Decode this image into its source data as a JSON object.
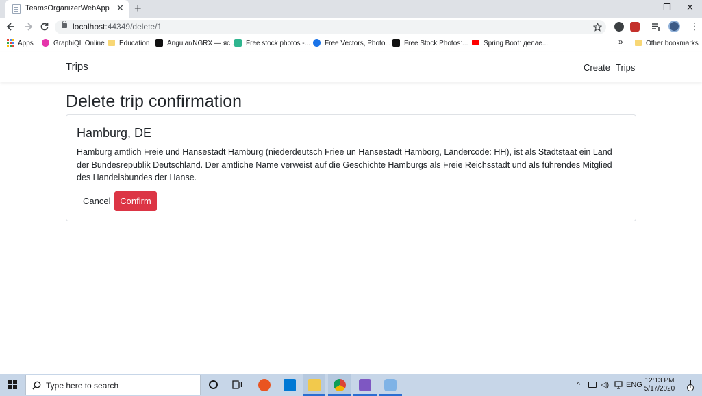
{
  "browser": {
    "tab_title": "TeamsOrganizerWebApp",
    "close_glyph": "✕",
    "new_tab_glyph": "+",
    "url_host": "localhost",
    "url_rest": ":44349/delete/1",
    "window_controls": [
      "—",
      "❐",
      "✕"
    ],
    "icons": {
      "back": "back-arrow-icon",
      "forward": "forward-arrow-icon",
      "reload": "reload-icon",
      "star": "star-icon",
      "menu": "more-vert-icon"
    }
  },
  "bookmarks": {
    "apps": "Apps",
    "items": [
      {
        "label": "GraphiQL Online",
        "color": "#e535ab"
      },
      {
        "label": "Education",
        "color": "#f8d775"
      },
      {
        "label": "Angular/NGRX — яс...",
        "color": "#111111"
      },
      {
        "label": "Free stock photos -...",
        "color": "#2fb58f"
      },
      {
        "label": "Free Vectors, Photo...",
        "color": "#1a73e8"
      },
      {
        "label": "Free Stock Photos:...",
        "color": "#111111"
      },
      {
        "label": "Spring Boot: делае...",
        "color": "#ff0000"
      }
    ],
    "overflow": "»",
    "other": "Other bookmarks"
  },
  "navbar": {
    "brand": "Trips",
    "links": [
      "Create",
      "Trips"
    ]
  },
  "page": {
    "heading": "Delete trip confirmation",
    "card": {
      "title": "Hamburg, DE",
      "text": "Hamburg amtlich Freie und Hansestadt Hamburg (niederdeutsch Friee un Hansestadt Hamborg, Ländercode: HH), ist als Stadtstaat ein Land der Bundesrepublik Deutschland. Der amtliche Name verweist auf die Geschichte Hamburgs als Freie Reichsstadt und als führendes Mitglied des Handelsbundes der Hanse.",
      "cancel_label": "Cancel",
      "confirm_label": "Confirm",
      "confirm_color": "#dc3545"
    }
  },
  "taskbar": {
    "search_placeholder": "Type here to search",
    "language": "ENG",
    "time": "12:13 PM",
    "date": "5/17/2020",
    "notification_count": "1"
  }
}
